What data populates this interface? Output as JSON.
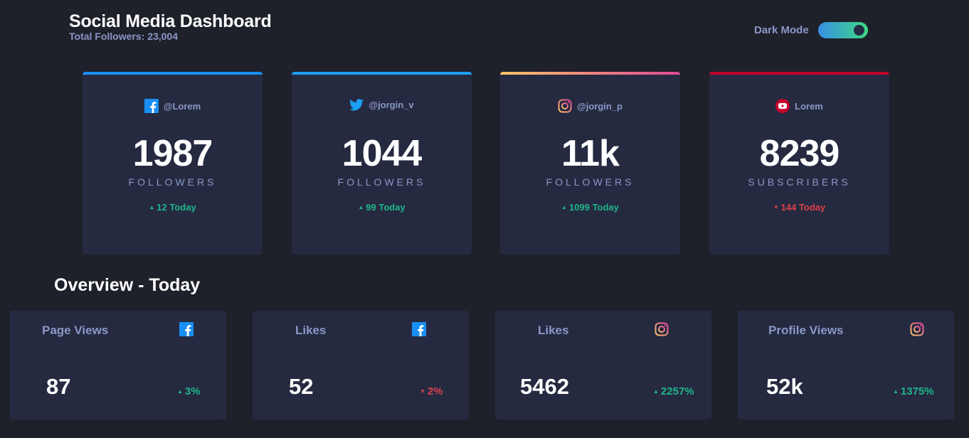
{
  "header": {
    "title": "Social Media Dashboard",
    "subtitle": "Total Followers: 23,004",
    "toggle_label": "Dark Mode"
  },
  "cards": [
    {
      "network": "facebook",
      "icon": "facebook-icon",
      "handle": "@Lorem",
      "count": "1987",
      "unit": "FOLLOWERS",
      "today": "12 Today",
      "trend": "up",
      "accent": "#198ff5"
    },
    {
      "network": "twitter",
      "icon": "twitter-icon",
      "handle": "@jorgin_v",
      "count": "1044",
      "unit": "FOLLOWERS",
      "today": "99 Today",
      "trend": "up",
      "accent": "#1ca0f2"
    },
    {
      "network": "instagram",
      "icon": "instagram-icon",
      "handle": "@jorgin_p",
      "count": "11k",
      "unit": "FOLLOWERS",
      "today": "1099 Today",
      "trend": "up",
      "accent": "#fdc468"
    },
    {
      "network": "youtube",
      "icon": "youtube-icon",
      "handle": "Lorem",
      "count": "8239",
      "unit": "SUBSCRIBERS",
      "today": "144 Today",
      "trend": "down",
      "accent": "#c4032a"
    }
  ],
  "overview": {
    "title": "Overview - Today",
    "items": [
      {
        "label": "Page Views",
        "icon": "facebook-icon",
        "value": "87",
        "pct": "3%",
        "trend": "up"
      },
      {
        "label": "Likes",
        "icon": "facebook-icon",
        "value": "52",
        "pct": "2%",
        "trend": "down"
      },
      {
        "label": "Likes",
        "icon": "instagram-icon",
        "value": "5462",
        "pct": "2257%",
        "trend": "up"
      },
      {
        "label": "Profile Views",
        "icon": "instagram-icon",
        "value": "52k",
        "pct": "1375%",
        "trend": "up"
      }
    ]
  },
  "colors": {
    "up": "#1eb589",
    "down": "#dc414c",
    "facebook": "#198ff5",
    "twitter": "#1ca0f2",
    "youtube": "#c4032a"
  }
}
